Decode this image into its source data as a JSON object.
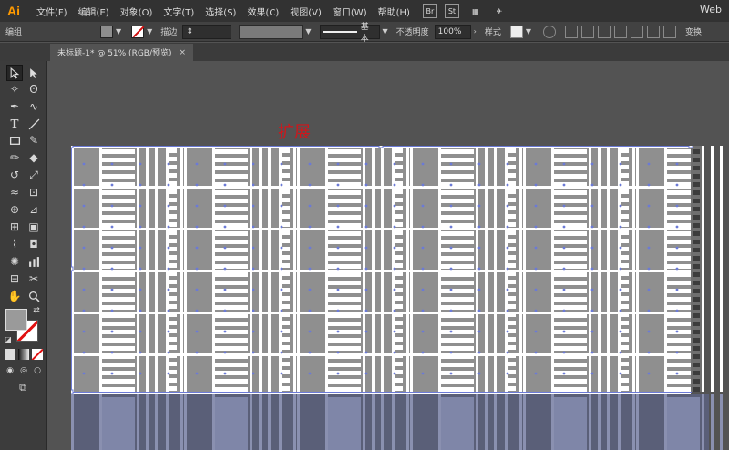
{
  "app": {
    "logo": "Ai"
  },
  "menu": {
    "items": [
      "文件(F)",
      "编辑(E)",
      "对象(O)",
      "文字(T)",
      "选择(S)",
      "效果(C)",
      "视图(V)",
      "窗口(W)",
      "帮助(H)"
    ],
    "bridge_badge": "Br",
    "stock_badge": "St",
    "workspace": "Web"
  },
  "control_bar": {
    "selection_label": "编组",
    "stroke_label": "描边",
    "stroke_style": "基本",
    "opacity_label": "不透明度",
    "opacity_value": "100%",
    "style_label": "样式",
    "transform_label": "变换"
  },
  "document_tab": {
    "title": "未标题-1* @ 51% (RGB/预览)",
    "close": "×"
  },
  "canvas": {
    "annotation": "扩展"
  },
  "colors": {
    "fill": "#9a9a9a",
    "stroke_none": "#e01010",
    "guide": "#6b7ad6",
    "accent": "#ff9a00"
  },
  "icons": [
    "selection-tool-icon",
    "direct-selection-icon",
    "magic-wand-icon",
    "lasso-icon",
    "pen-icon",
    "curvature-icon",
    "type-icon",
    "line-icon",
    "rectangle-icon",
    "paintbrush-icon",
    "pencil-icon",
    "eraser-icon",
    "rotate-icon",
    "scale-icon",
    "width-icon",
    "free-transform-icon",
    "shape-builder-icon",
    "perspective-icon",
    "mesh-icon",
    "gradient-icon",
    "eyedropper-icon",
    "blend-icon",
    "symbol-sprayer-icon",
    "graph-icon",
    "artboard-icon",
    "slice-icon",
    "hand-icon",
    "zoom-icon"
  ]
}
